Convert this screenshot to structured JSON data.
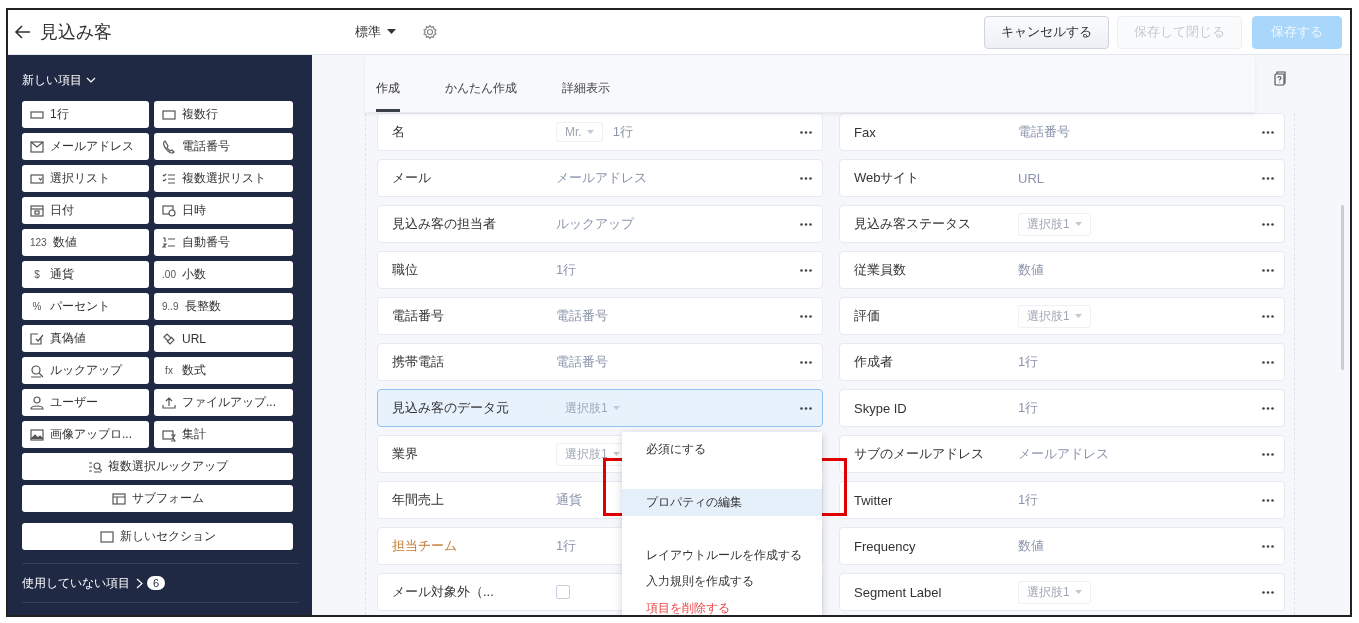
{
  "header": {
    "title": "見込み客",
    "layout": "標準",
    "buttons": [
      {
        "label": "キャンセルする",
        "kind": "secondary",
        "disabled": false
      },
      {
        "label": "保存して閉じる",
        "kind": "secondary",
        "disabled": true
      },
      {
        "label": "保存する",
        "kind": "primary",
        "disabled": true
      }
    ]
  },
  "sidebar": {
    "heading": "新しい項目",
    "items": [
      {
        "label": "1行",
        "kind": "half"
      },
      {
        "label": "複数行",
        "kind": "half"
      },
      {
        "label": "メールアドレス",
        "kind": "half"
      },
      {
        "label": "電話番号",
        "kind": "half"
      },
      {
        "label": "選択リスト",
        "kind": "half"
      },
      {
        "label": "複数選択リスト",
        "kind": "half"
      },
      {
        "label": "日付",
        "kind": "half"
      },
      {
        "label": "日時",
        "kind": "half"
      },
      {
        "label": "数値",
        "kind": "half",
        "glyph": "123"
      },
      {
        "label": "自動番号",
        "kind": "half"
      },
      {
        "label": "通貨",
        "kind": "half",
        "glyph": "$"
      },
      {
        "label": "小数",
        "kind": "half",
        "glyph": ".00"
      },
      {
        "label": "パーセント",
        "kind": "half",
        "glyph": "%"
      },
      {
        "label": "長整数",
        "kind": "half",
        "glyph": "9..9"
      },
      {
        "label": "真偽値",
        "kind": "half"
      },
      {
        "label": "URL",
        "kind": "half"
      },
      {
        "label": "ルックアップ",
        "kind": "half"
      },
      {
        "label": "数式",
        "kind": "half",
        "glyph": "fx"
      },
      {
        "label": "ユーザー",
        "kind": "half"
      },
      {
        "label": "ファイルアップ...",
        "kind": "half"
      },
      {
        "label": "画像アップロ...",
        "kind": "half"
      },
      {
        "label": "集計",
        "kind": "half"
      },
      {
        "label": "複数選択ルックアップ",
        "kind": "full"
      },
      {
        "label": "サブフォーム",
        "kind": "full"
      },
      {
        "label": "新しいセクション",
        "kind": "section"
      }
    ],
    "unused": {
      "label": "使用していない項目",
      "count": "6"
    }
  },
  "tabs": [
    {
      "label": "作成",
      "selected": true
    },
    {
      "label": "かんたん作成",
      "selected": false
    },
    {
      "label": "詳細表示",
      "selected": false
    }
  ],
  "field_columns": [
    [
      {
        "label": "名",
        "kind": "name",
        "salutation": "Mr.",
        "placeholder": "1行",
        "accent": false,
        "selected": false
      },
      {
        "label": "メール",
        "kind": "text",
        "placeholder": "メールアドレス",
        "accent": false,
        "selected": false
      },
      {
        "label": "見込み客の担当者",
        "kind": "text",
        "placeholder": "ルックアップ",
        "accent": false,
        "selected": false
      },
      {
        "label": "職位",
        "kind": "text",
        "placeholder": "1行",
        "accent": false,
        "selected": false
      },
      {
        "label": "電話番号",
        "kind": "text",
        "placeholder": "電話番号",
        "accent": false,
        "selected": false
      },
      {
        "label": "携帯電話",
        "kind": "text",
        "placeholder": "電話番号",
        "accent": false,
        "selected": false
      },
      {
        "label": "見込み客のデータ元",
        "kind": "select",
        "placeholder": "選択肢1",
        "accent": false,
        "selected": true
      },
      {
        "label": "業界",
        "kind": "select",
        "placeholder": "選択肢1",
        "accent": false,
        "selected": false
      },
      {
        "label": "年間売上",
        "kind": "text",
        "placeholder": "通貨",
        "accent": false,
        "selected": false
      },
      {
        "label": "担当チーム",
        "kind": "text",
        "placeholder": "1行",
        "accent": true,
        "selected": false
      },
      {
        "label": "メール対象外（...",
        "kind": "checkbox",
        "accent": false,
        "selected": false
      }
    ],
    [
      {
        "label": "Fax",
        "kind": "text",
        "placeholder": "電話番号",
        "accent": false,
        "selected": false
      },
      {
        "label": "Webサイト",
        "kind": "text",
        "placeholder": "URL",
        "accent": false,
        "selected": false
      },
      {
        "label": "見込み客ステータス",
        "kind": "select",
        "placeholder": "選択肢1",
        "accent": false,
        "selected": false
      },
      {
        "label": "従業員数",
        "kind": "text",
        "placeholder": "数値",
        "accent": false,
        "selected": false
      },
      {
        "label": "評価",
        "kind": "select",
        "placeholder": "選択肢1",
        "accent": false,
        "selected": false
      },
      {
        "label": "作成者",
        "kind": "text",
        "placeholder": "1行",
        "accent": false,
        "selected": false
      },
      {
        "label": "Skype ID",
        "kind": "text",
        "placeholder": "1行",
        "accent": false,
        "selected": false
      },
      {
        "label": "サブのメールアドレス",
        "kind": "text",
        "placeholder": "メールアドレス",
        "accent": false,
        "selected": false
      },
      {
        "label": "Twitter",
        "kind": "text",
        "placeholder": "1行",
        "accent": false,
        "selected": false
      },
      {
        "label": "Frequency",
        "kind": "text",
        "placeholder": "数値",
        "accent": false,
        "selected": false
      },
      {
        "label": "Segment Label",
        "kind": "select",
        "placeholder": "選択肢1",
        "accent": false,
        "selected": false
      }
    ]
  ],
  "context_menu": {
    "items": [
      {
        "label": "必須にする",
        "kind": "normal",
        "selected": false
      },
      {
        "kind": "obscured"
      },
      {
        "label": "プロパティの編集",
        "kind": "normal",
        "selected": true
      },
      {
        "kind": "obscured"
      },
      {
        "label": "レイアウトルールを作成する",
        "kind": "normal",
        "selected": false
      },
      {
        "label": "入力規則を作成する",
        "kind": "normal",
        "selected": false
      },
      {
        "label": "項目を削除する",
        "kind": "danger",
        "selected": false
      }
    ]
  },
  "annotation": {
    "kind": "highlight-frame"
  }
}
